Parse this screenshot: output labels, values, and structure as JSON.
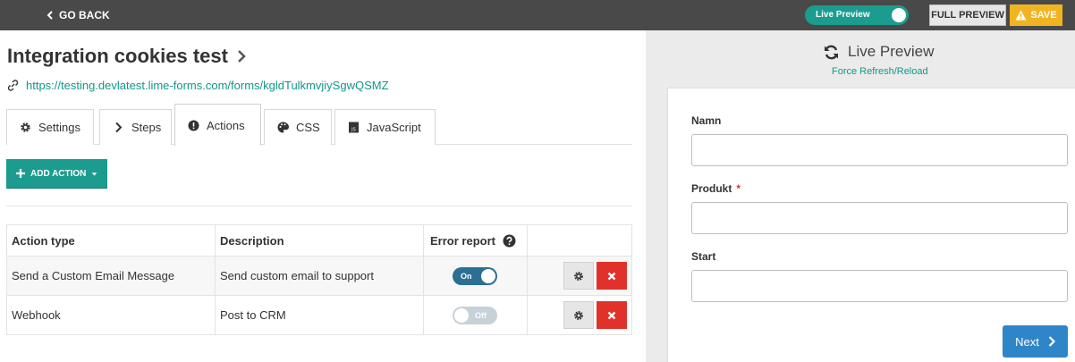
{
  "topbar": {
    "go_back": "GO BACK",
    "live_preview_toggle": "Live Preview",
    "full_preview": "FULL PREVIEW",
    "save": "SAVE"
  },
  "form": {
    "title": "Integration cookies test",
    "url": "https://testing.devlatest.lime-forms.com/forms/kgldTulkmvjiySgwQSMZ"
  },
  "tabs": [
    {
      "label": "Settings",
      "icon": "gear-icon"
    },
    {
      "label": "Steps",
      "icon": "chevron-right-icon"
    },
    {
      "label": "Actions",
      "icon": "exclamation-circle-icon",
      "active": true
    },
    {
      "label": "CSS",
      "icon": "palette-icon"
    },
    {
      "label": "JavaScript",
      "icon": "js-file-icon"
    }
  ],
  "add_action": "ADD ACTION",
  "table": {
    "headers": [
      "Action type",
      "Description",
      "Error report",
      ""
    ],
    "rows": [
      {
        "type": "Send a Custom Email Message",
        "description": "Send custom email to support",
        "toggle": "On",
        "on": true
      },
      {
        "type": "Webhook",
        "description": "Post to CRM",
        "toggle": "Off",
        "on": false
      }
    ]
  },
  "preview": {
    "title": "Live Preview",
    "refresh": "Force Refresh/Reload",
    "fields": [
      {
        "label": "Namn",
        "required": false
      },
      {
        "label": "Produkt",
        "required": true,
        "required_mark": "*"
      },
      {
        "label": "Start",
        "required": false
      }
    ],
    "next": "Next"
  },
  "colors": {
    "topbar": "#494949",
    "teal": "#1b9c8f",
    "save": "#f1b421",
    "danger": "#e0322b",
    "toggle_on": "#2b6f93",
    "next": "#2e86c8"
  }
}
